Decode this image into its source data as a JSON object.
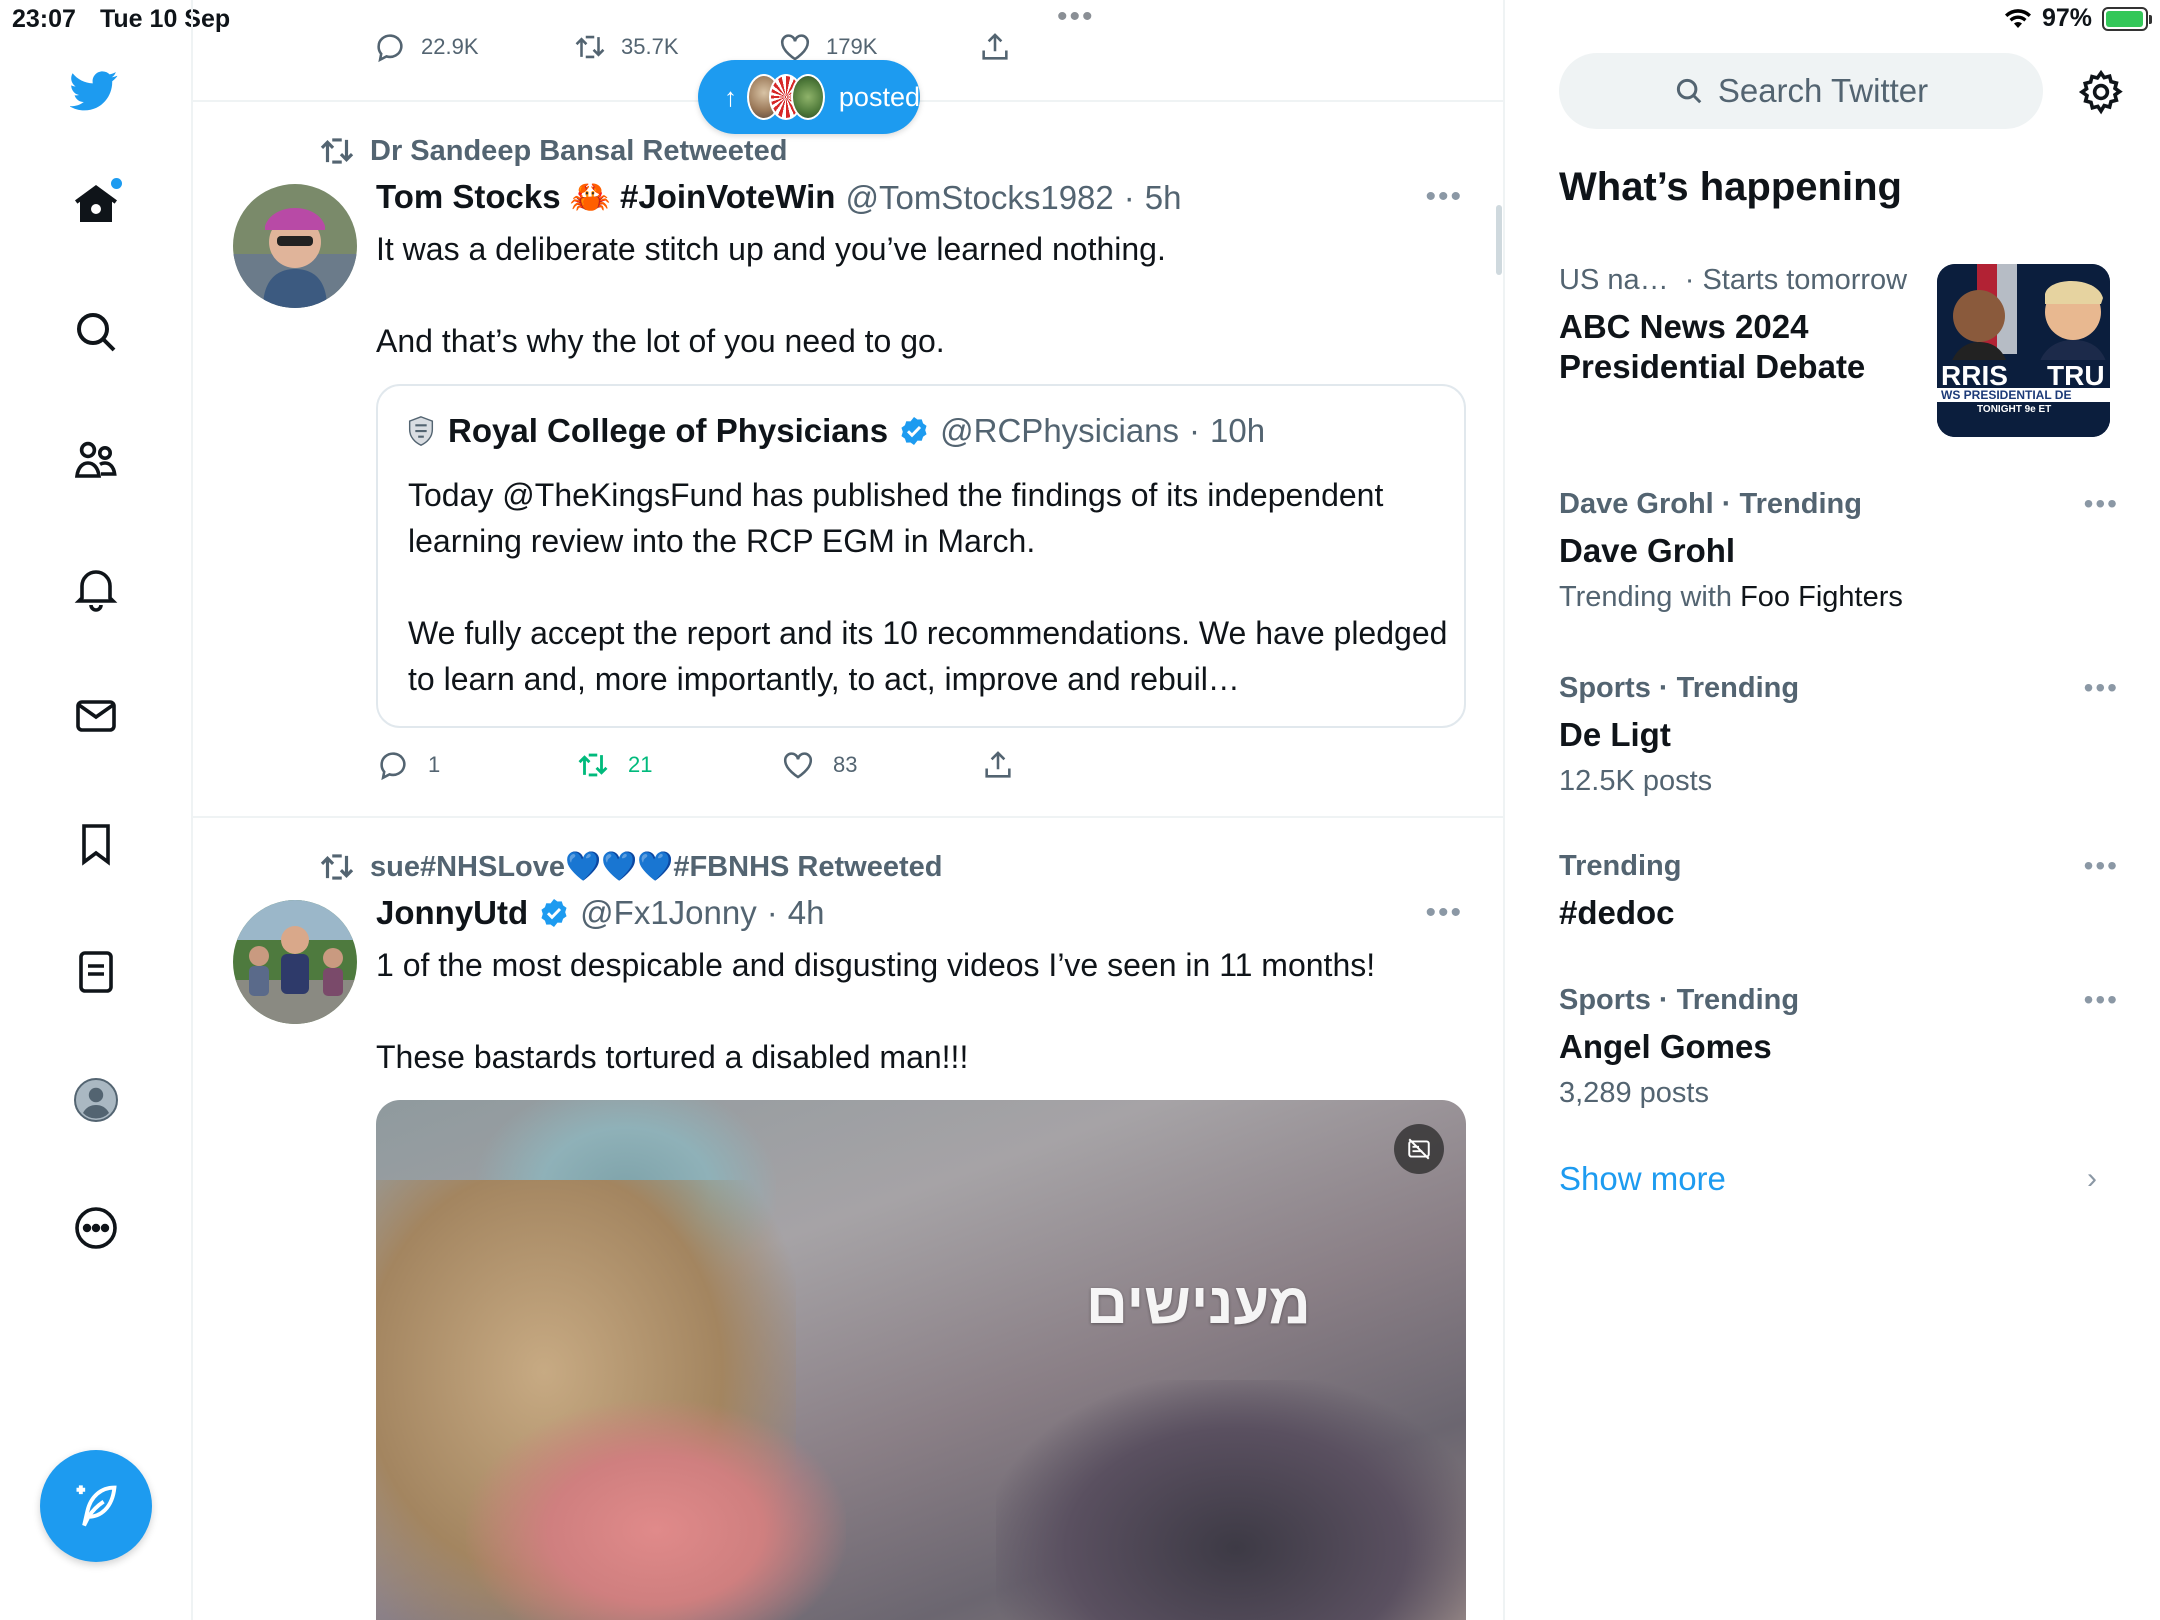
{
  "status_bar": {
    "time": "23:07",
    "date": "Tue 10 Sep",
    "battery": "97%",
    "battery_level": 0.97
  },
  "nav": {
    "items": [
      "twitter-logo",
      "home",
      "explore",
      "communities",
      "notifications",
      "messages",
      "bookmarks",
      "lists",
      "profile",
      "more"
    ]
  },
  "prev_tweet": {
    "replies": "22.9K",
    "retweets": "35.7K",
    "likes": "179K"
  },
  "new_posts_pill": {
    "label": "posted"
  },
  "tweet1": {
    "retweeted_by": "Dr Sandeep Bansal Retweeted",
    "name": "Tom Stocks 🦀 #JoinVoteWin",
    "handle": "@TomStocks1982",
    "time": "5h",
    "text": "It was a deliberate stitch up and you’ve learned nothing.\n\nAnd that’s why the lot of you need to go.",
    "quote": {
      "name": "Royal College of Physicians",
      "handle": "@RCPhysicians",
      "time": "10h",
      "text": "Today @TheKingsFund has published the findings of its independent learning review into the RCP EGM in March.\n\nWe fully accept the report and its 10 recommendations. We have pledged to learn and, more importantly, to act, improve and rebuil…"
    },
    "replies": "1",
    "retweets": "21",
    "likes": "83"
  },
  "tweet2": {
    "retweeted_by": "sue#NHSLove💙💙💙#FBNHS Retweeted",
    "name": "JonnyUtd",
    "handle": "@Fx1Jonny",
    "time": "4h",
    "text": "1 of the most despicable and disgusting videos I’ve seen in 11 months!\n\nThese bastards tortured a disabled man!!!",
    "media_caption": "מענישים"
  },
  "sidebar": {
    "search_placeholder": "Search Twitter",
    "section_title": "What’s happening",
    "trends": [
      {
        "meta_a": "US na…",
        "meta_b": "· Starts tomorrow",
        "title": "ABC News 2024 Presidential Debate",
        "sub": "",
        "sub_dark": ""
      },
      {
        "meta_a": "Dave Grohl · Trending",
        "meta_b": "",
        "title": "Dave Grohl",
        "sub": "Trending with",
        "sub_dark": "Foo Fighters"
      },
      {
        "meta_a": "Sports · Trending",
        "meta_b": "",
        "title": "De Ligt",
        "sub": "12.5K posts",
        "sub_dark": ""
      },
      {
        "meta_a": "Trending",
        "meta_b": "",
        "title": "#dedoc",
        "sub": "",
        "sub_dark": ""
      },
      {
        "meta_a": "Sports · Trending",
        "meta_b": "",
        "title": "Angel Gomes",
        "sub": "3,289 posts",
        "sub_dark": ""
      }
    ],
    "trend_thumb_text": {
      "left": "RRIS",
      "right": "TRU",
      "banner": "WS PRESIDENTIAL DE",
      "time": "TONIGHT 9e ET"
    },
    "show_more": "Show more"
  },
  "colors": {
    "accent": "#1d9bf0",
    "retweet_green": "#00ba7c",
    "muted": "#536471",
    "text": "#0f1419"
  }
}
